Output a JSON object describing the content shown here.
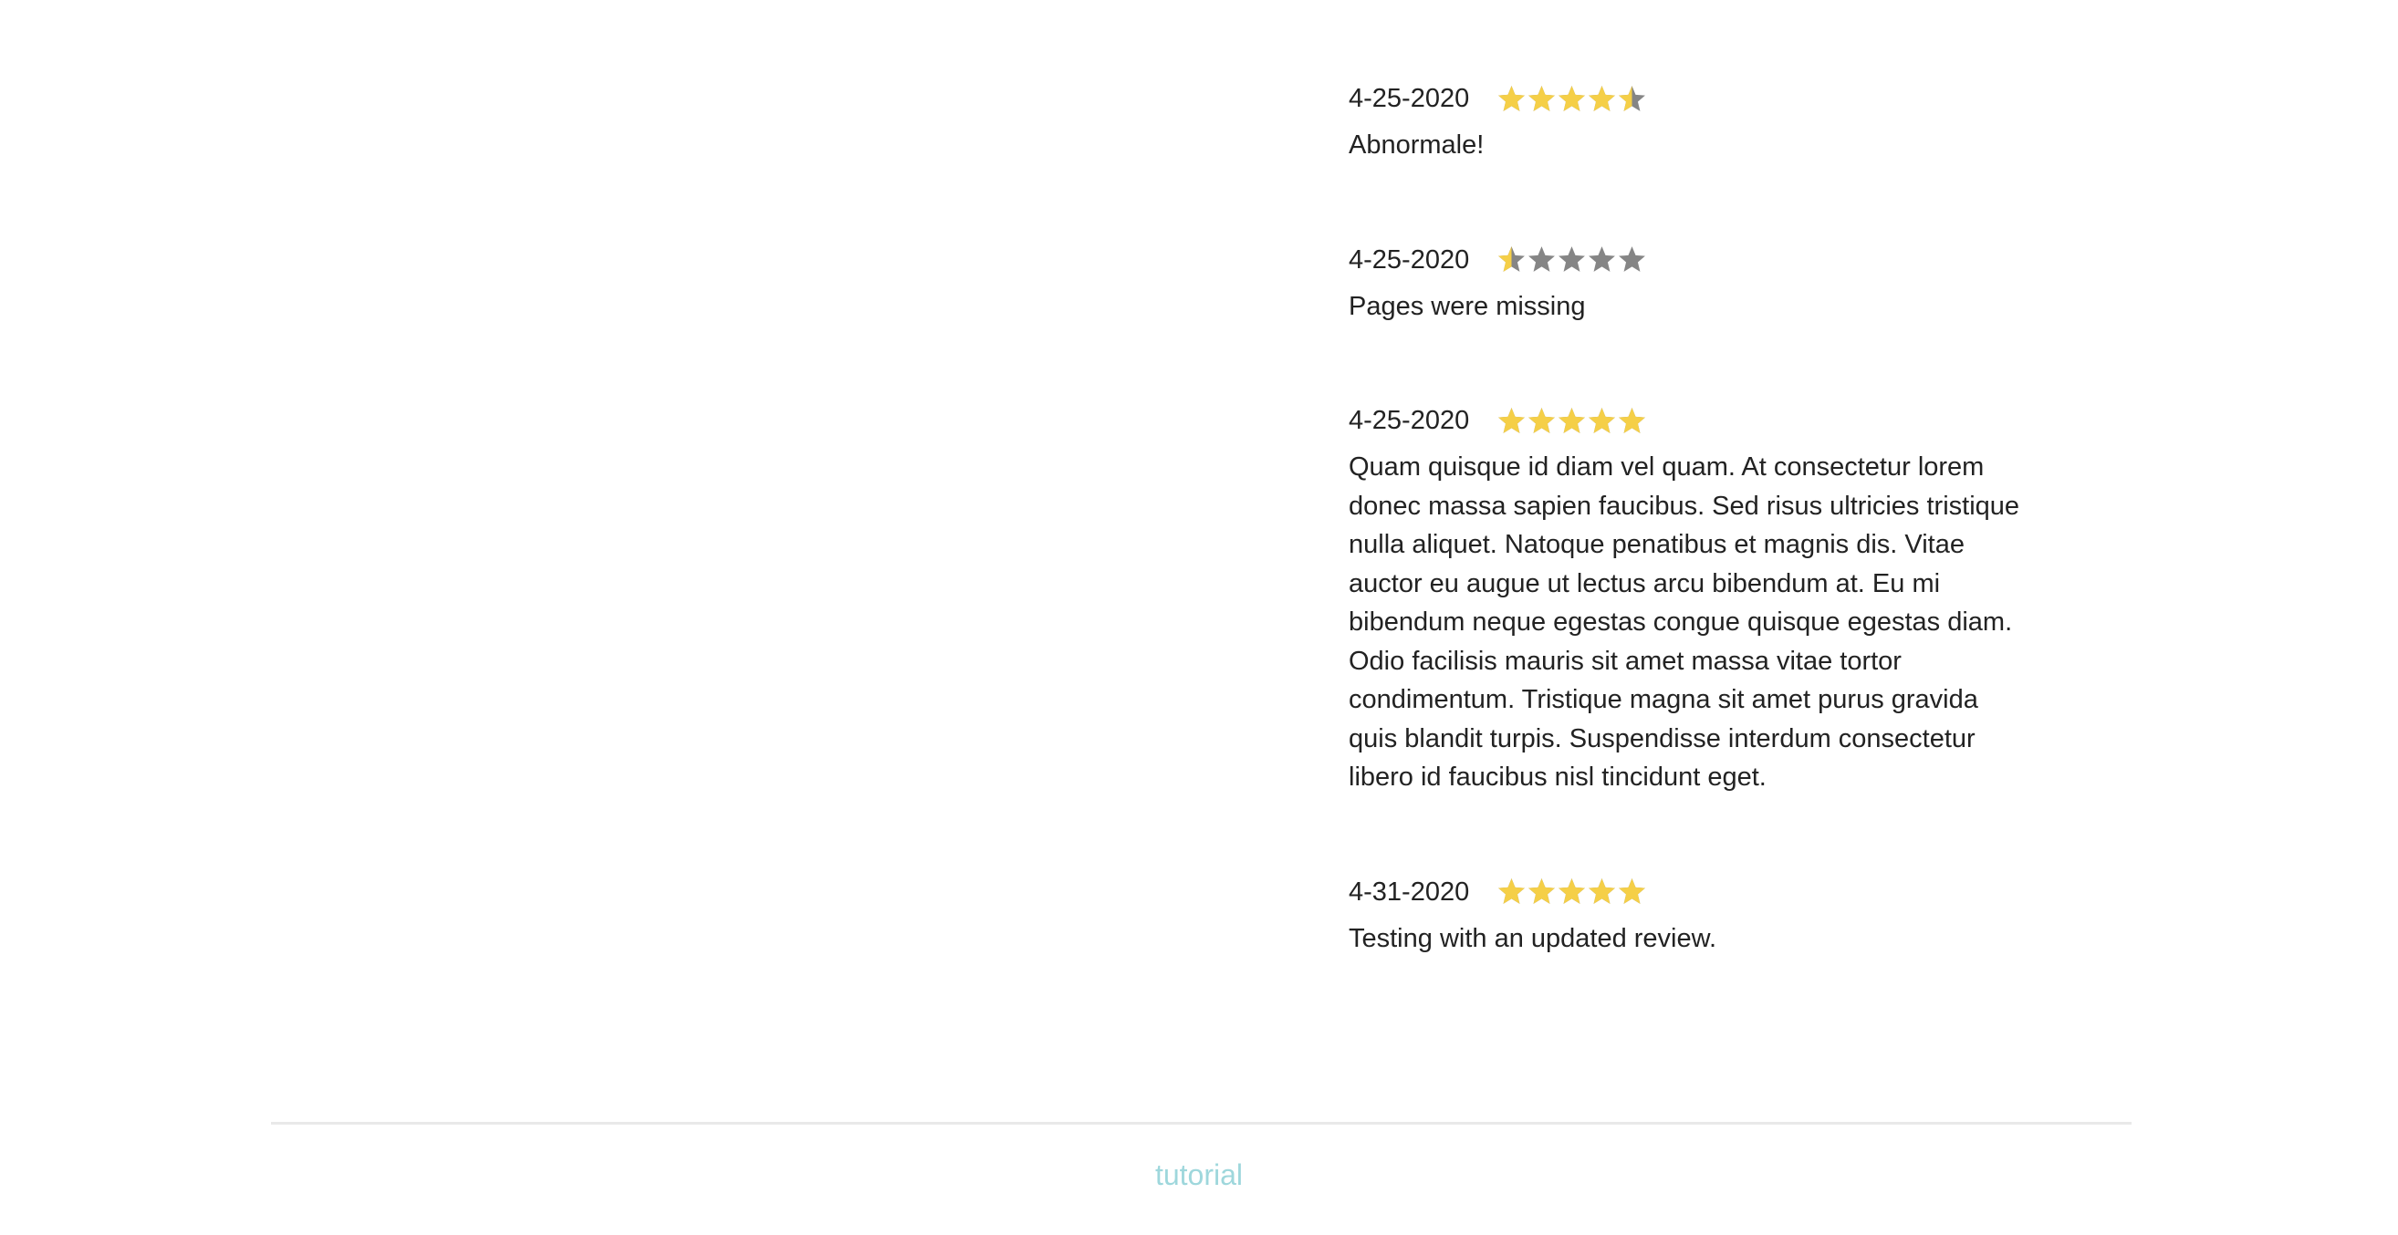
{
  "colors": {
    "star_filled": "#f5cf47",
    "star_empty": "#858585",
    "text": "#222222",
    "footer_link": "#9ed7dc",
    "rule": "#e9e9e9"
  },
  "reviews": [
    {
      "date": "4-25-2020",
      "rating": 4.5,
      "max_rating": 5,
      "text": "Abnormale!"
    },
    {
      "date": "4-25-2020",
      "rating": 0.5,
      "max_rating": 5,
      "text": "Pages were missing"
    },
    {
      "date": "4-25-2020",
      "rating": 5,
      "max_rating": 5,
      "text": "Quam quisque id diam vel quam. At consectetur lorem donec massa sapien faucibus. Sed risus ultricies tristique nulla aliquet. Natoque penatibus et magnis dis. Vitae auctor eu augue ut lectus arcu bibendum at. Eu mi bibendum neque egestas congue quisque egestas diam. Odio facilisis mauris sit amet massa vitae tortor condimentum. Tristique magna sit amet purus gravida quis blandit turpis. Suspendisse interdum consectetur libero id faucibus nisl tincidunt eget."
    },
    {
      "date": "4-31-2020",
      "rating": 5,
      "max_rating": 5,
      "text": "Testing with an updated review."
    }
  ],
  "footer": {
    "link_label": "tutorial"
  }
}
